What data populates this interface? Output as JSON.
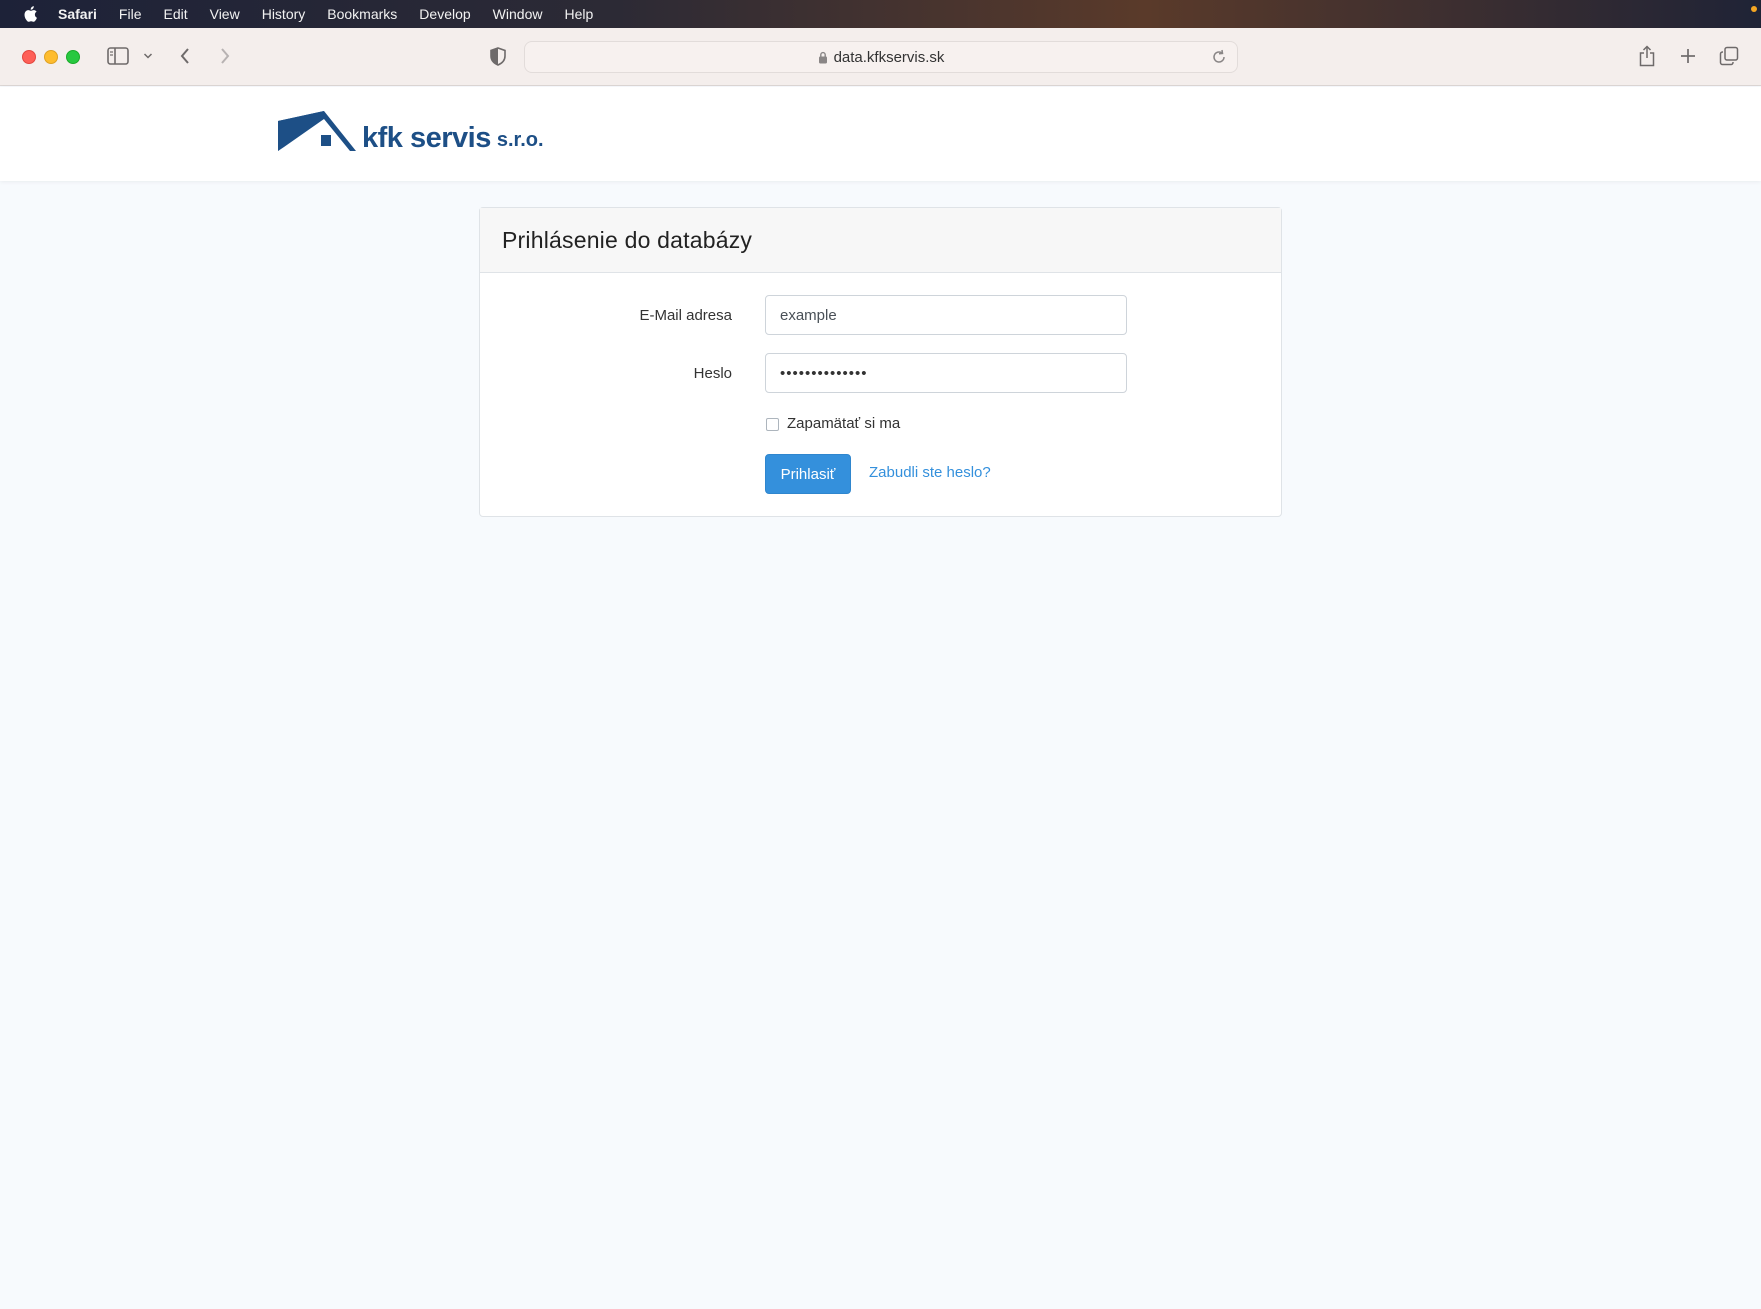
{
  "menubar": {
    "app_name": "Safari",
    "items": [
      "File",
      "Edit",
      "View",
      "History",
      "Bookmarks",
      "Develop",
      "Window",
      "Help"
    ]
  },
  "browser": {
    "url": "data.kfkservis.sk"
  },
  "header": {
    "logo_text": "kfk servis",
    "logo_suffix": "s.r.o."
  },
  "login": {
    "title": "Prihlásenie do databázy",
    "email_label": "E-Mail adresa",
    "email_value": "example",
    "password_label": "Heslo",
    "password_value": "••••••••••••••",
    "remember_label": "Zapamätať si ma",
    "submit_label": "Prihlasiť",
    "forgot_label": "Zabudli ste heslo?"
  },
  "colors": {
    "brand": "#1d4f86",
    "accent": "#3490dc",
    "page_bg": "#f7fafd"
  }
}
